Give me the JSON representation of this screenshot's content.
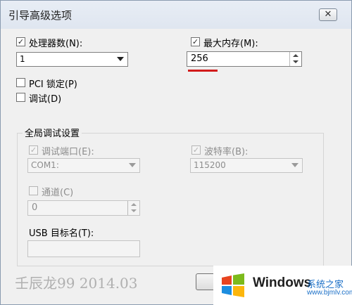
{
  "window": {
    "title": "引导高级选项",
    "close_label": "✕"
  },
  "processors": {
    "label": "处理器数(N):",
    "checked": true,
    "value": "1"
  },
  "max_memory": {
    "label": "最大内存(M):",
    "checked": true,
    "value": "256"
  },
  "pci_lock": {
    "label": "PCI 锁定(P)",
    "checked": false
  },
  "debug": {
    "label": "调试(D)",
    "checked": false
  },
  "global_debug": {
    "title": "全局调试设置",
    "debug_port": {
      "label": "调试端口(E):",
      "checked": true,
      "value": "COM1:"
    },
    "baud_rate": {
      "label": "波特率(B):",
      "checked": true,
      "value": "115200"
    },
    "channel": {
      "label": "通道(C)",
      "checked": false,
      "value": "0"
    },
    "usb_target": {
      "label": "USB 目标名(T):",
      "value": ""
    }
  },
  "watermark": "壬辰龙99  2014.03",
  "brand": {
    "name": "Windows",
    "sub": "系统之家",
    "url": "www.bjmlv.com"
  },
  "colors": {
    "accent_underline": "#d21b1b",
    "titlebar": "#dfe6f0",
    "dialog_bg": "#f0f0f0"
  }
}
